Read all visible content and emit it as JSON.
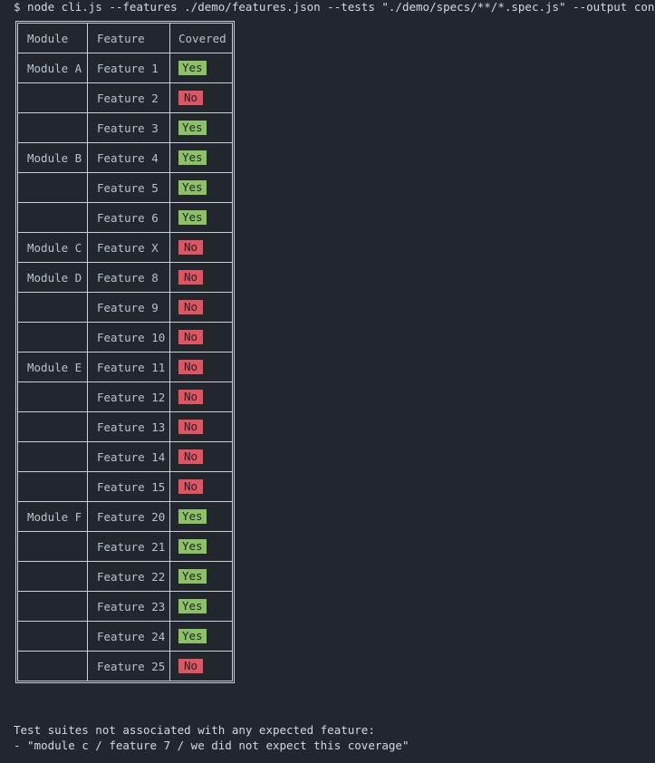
{
  "command": "$ node cli.js --features ./demo/features.json --tests \"./demo/specs/**/*.spec.js\" --output console",
  "table": {
    "headers": [
      "Module",
      "Feature",
      "Covered"
    ],
    "rows": [
      {
        "module": "Module A",
        "feature": "Feature 1",
        "covered": "Yes"
      },
      {
        "module": "",
        "feature": "Feature 2",
        "covered": "No"
      },
      {
        "module": "",
        "feature": "Feature 3",
        "covered": "Yes"
      },
      {
        "module": "Module B",
        "feature": "Feature 4",
        "covered": "Yes"
      },
      {
        "module": "",
        "feature": "Feature 5",
        "covered": "Yes"
      },
      {
        "module": "",
        "feature": "Feature 6",
        "covered": "Yes"
      },
      {
        "module": "Module C",
        "feature": "Feature X",
        "covered": "No"
      },
      {
        "module": "Module D",
        "feature": "Feature 8",
        "covered": "No"
      },
      {
        "module": "",
        "feature": "Feature 9",
        "covered": "No"
      },
      {
        "module": "",
        "feature": "Feature 10",
        "covered": "No"
      },
      {
        "module": "Module E",
        "feature": "Feature 11",
        "covered": "No"
      },
      {
        "module": "",
        "feature": "Feature 12",
        "covered": "No"
      },
      {
        "module": "",
        "feature": "Feature 13",
        "covered": "No"
      },
      {
        "module": "",
        "feature": "Feature 14",
        "covered": "No"
      },
      {
        "module": "",
        "feature": "Feature 15",
        "covered": "No"
      },
      {
        "module": "Module F",
        "feature": "Feature 20",
        "covered": "Yes"
      },
      {
        "module": "",
        "feature": "Feature 21",
        "covered": "Yes"
      },
      {
        "module": "",
        "feature": "Feature 22",
        "covered": "Yes"
      },
      {
        "module": "",
        "feature": "Feature 23",
        "covered": "Yes"
      },
      {
        "module": "",
        "feature": "Feature 24",
        "covered": "Yes"
      },
      {
        "module": "",
        "feature": "Feature 25",
        "covered": "No"
      }
    ]
  },
  "colors": {
    "background": "#22272e",
    "yes": "#8cc265",
    "no": "#e05561",
    "border": "#c9cfd6"
  },
  "footer": {
    "line1": "Test suites not associated with any expected feature:",
    "line2": "- \"module c / feature 7 / we did not expect this coverage\""
  }
}
